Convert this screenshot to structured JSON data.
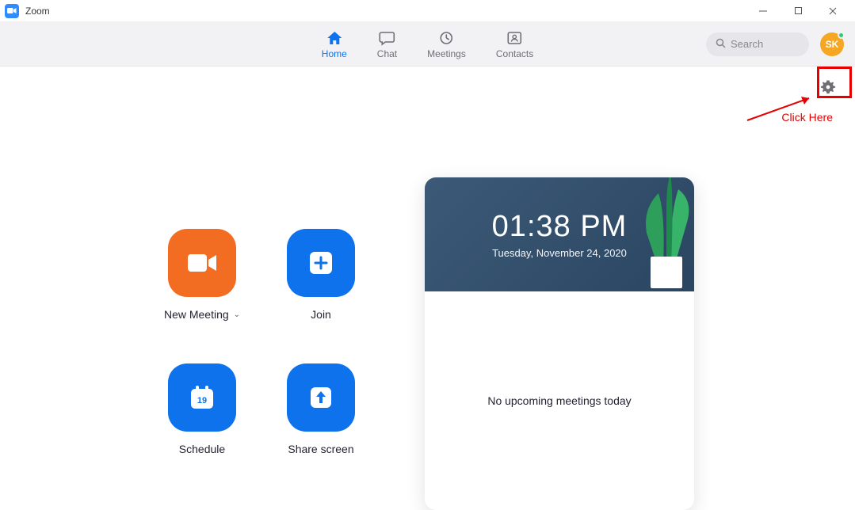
{
  "titlebar": {
    "app_name": "Zoom"
  },
  "nav": {
    "items": [
      {
        "label": "Home"
      },
      {
        "label": "Chat"
      },
      {
        "label": "Meetings"
      },
      {
        "label": "Contacts"
      }
    ],
    "search_placeholder": "Search",
    "avatar_initials": "SK"
  },
  "actions": {
    "new_meeting": "New Meeting",
    "join": "Join",
    "schedule": "Schedule",
    "schedule_day": "19",
    "share_screen": "Share screen"
  },
  "info": {
    "time": "01:38 PM",
    "date": "Tuesday, November 24, 2020",
    "no_meetings": "No upcoming meetings today"
  },
  "annotation": {
    "text": "Click Here"
  }
}
